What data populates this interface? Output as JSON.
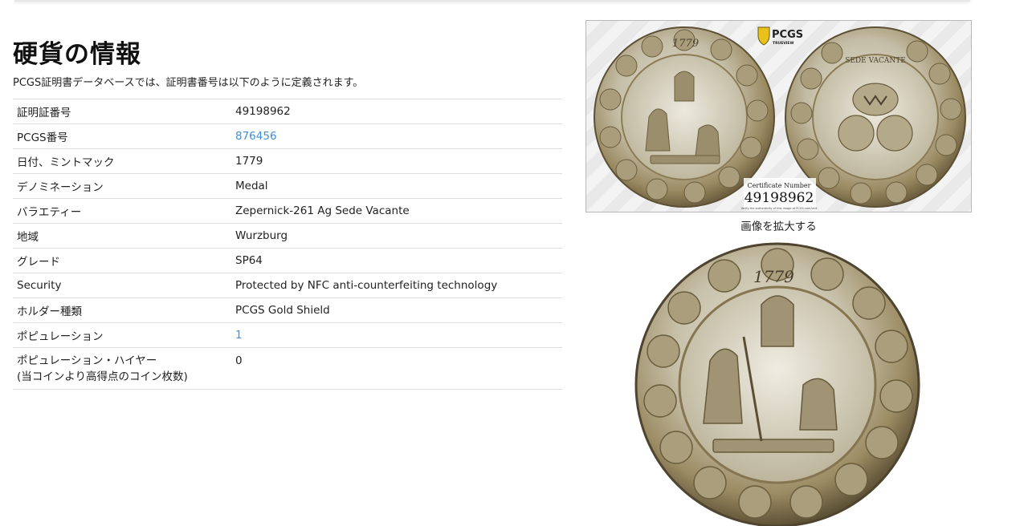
{
  "header": {
    "title": "硬貨の情報",
    "intro": "PCGS証明書データベースでは、証明書番号は以下のように定義されます。"
  },
  "details": [
    {
      "label": "証明証番号",
      "value": "49198962",
      "link": false
    },
    {
      "label": "PCGS番号",
      "value": "876456",
      "link": true
    },
    {
      "label": "日付、ミントマック",
      "value": "1779",
      "link": false
    },
    {
      "label": "デノミネーション",
      "value": "Medal",
      "link": false
    },
    {
      "label": "バラエティー",
      "value": "Zepernick-261 Ag Sede Vacante",
      "link": false
    },
    {
      "label": "地域",
      "value": "Wurzburg",
      "link": false
    },
    {
      "label": "グレード",
      "value": "SP64",
      "link": false
    },
    {
      "label": "Security",
      "value": "Protected by NFC anti-counterfeiting technology",
      "link": false
    },
    {
      "label": "ホルダー種類",
      "value": "PCGS Gold Shield",
      "link": false
    },
    {
      "label": "ポピュレーション",
      "value": "1",
      "link": true
    },
    {
      "label": "ポピュレーション・ハイヤー",
      "label2": "(当コインより高得点のコイン枚数)",
      "value": "0",
      "link": false
    }
  ],
  "slab": {
    "brand": "PCGS",
    "sub_brand": "TRUEVIEW",
    "cert_label": "Certificate Number",
    "cert_number": "49198962",
    "verify_text": "Verify the authenticity of this image at PCGS.com/cert",
    "obverse_date": "1779",
    "reverse_legend": "SEDE VACANTE"
  },
  "caption": "画像を拡大する",
  "big_coin": {
    "date": "1779"
  },
  "colors": {
    "link": "#3d8fd8",
    "coin_silver": "#c9c3b0",
    "coin_toning": "#8a7a55"
  }
}
